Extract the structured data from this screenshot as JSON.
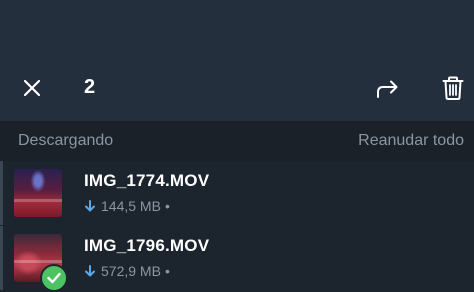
{
  "toolbar": {
    "selected_count": "2",
    "icons": {
      "close": "close-icon",
      "forward": "forward-icon",
      "delete": "trash-icon"
    }
  },
  "section": {
    "title": "Descargando",
    "action": "Reanudar todo"
  },
  "files": [
    {
      "name": "IMG_1774.MOV",
      "size": "144,5 MB",
      "separator": "•",
      "selected": true,
      "checked": false
    },
    {
      "name": "IMG_1796.MOV",
      "size": "572,9 MB",
      "separator": "•",
      "selected": true,
      "checked": true
    }
  ],
  "colors": {
    "accent_download": "#5aa8e8",
    "check_green": "#4cc262",
    "topbar_bg": "#242f3d",
    "list_bg": "#1c242d"
  }
}
